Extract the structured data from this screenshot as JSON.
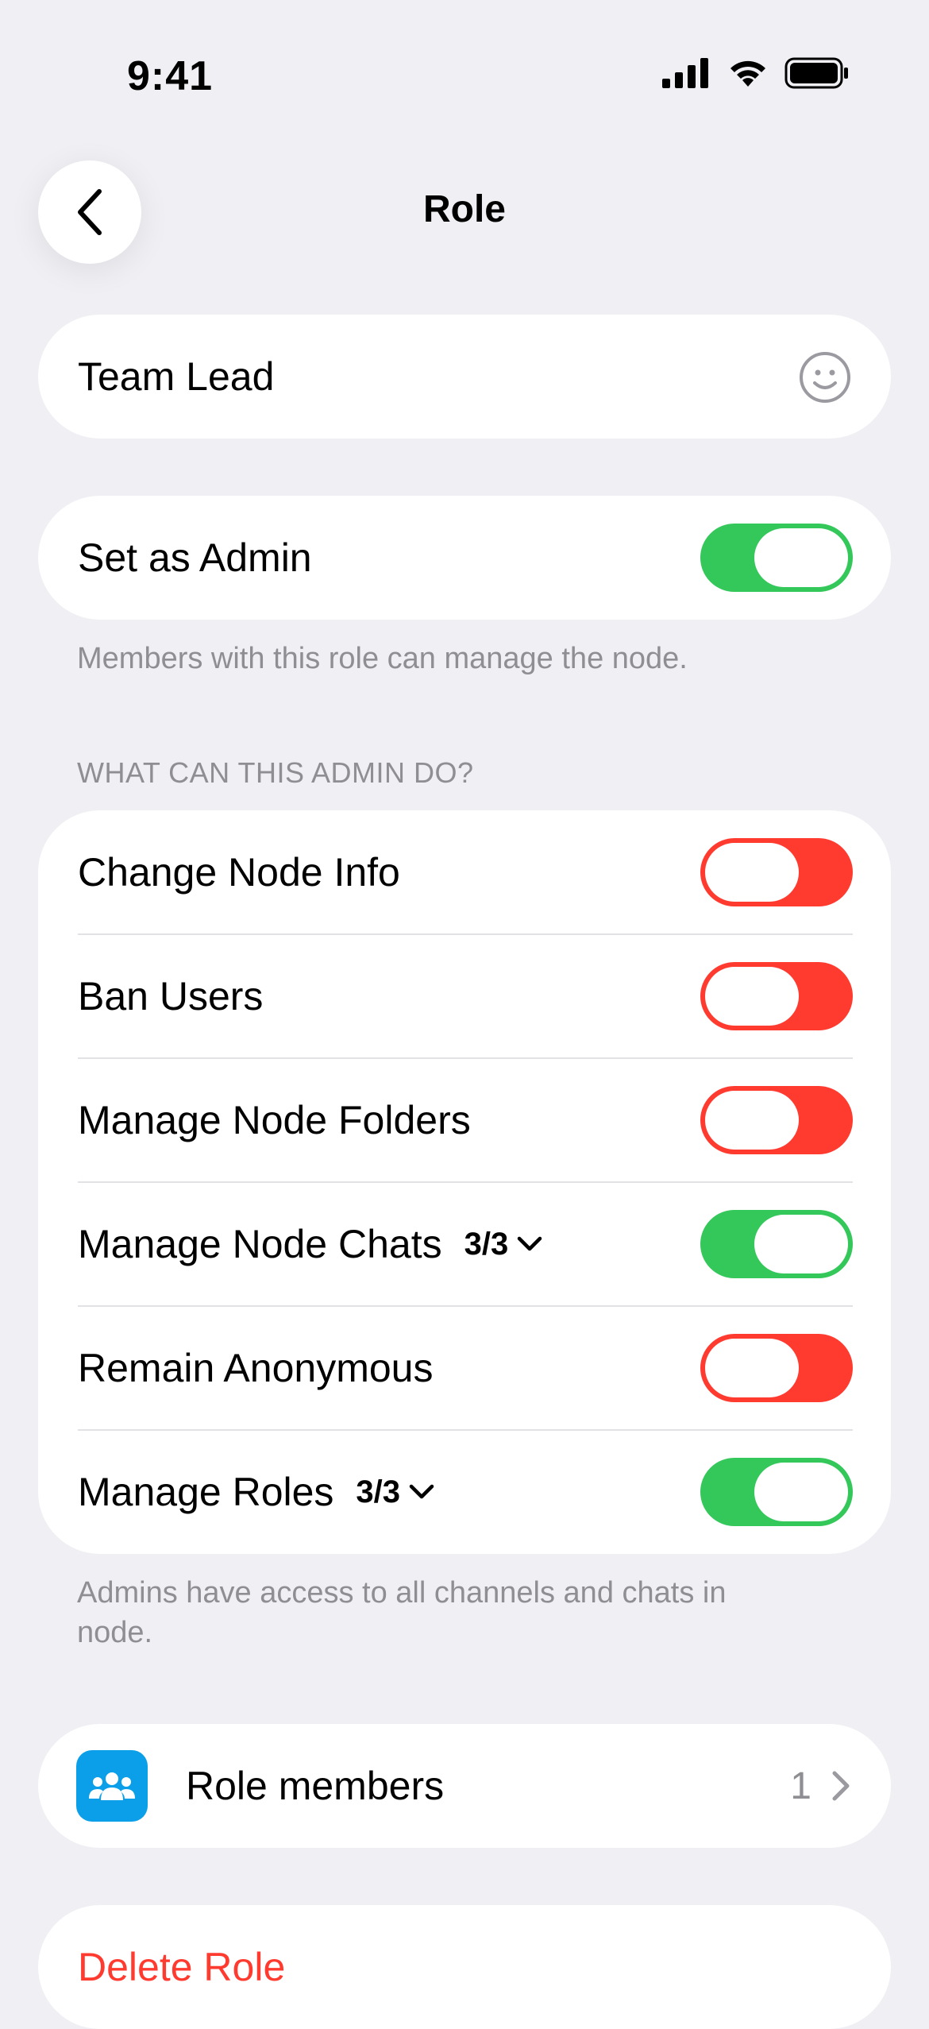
{
  "status_bar": {
    "time": "9:41"
  },
  "nav": {
    "title": "Role",
    "back_icon": "chevron-left-icon"
  },
  "role_name": {
    "value": "Team Lead",
    "icon": "smiley-icon"
  },
  "admin": {
    "label": "Set as Admin",
    "enabled": true,
    "footnote": "Members with this role can manage the node."
  },
  "permissions": {
    "header": "WHAT CAN THIS ADMIN DO?",
    "items": [
      {
        "label": "Change Node Info",
        "enabled": false
      },
      {
        "label": "Ban Users",
        "enabled": false
      },
      {
        "label": "Manage Node Folders",
        "enabled": false
      },
      {
        "label": "Manage Node Chats",
        "counter": "3/3",
        "enabled": true
      },
      {
        "label": "Remain Anonymous",
        "enabled": false
      },
      {
        "label": "Manage Roles",
        "counter": "3/3",
        "enabled": true
      }
    ],
    "footnote_line1": "Admins have access to all channels and chats in",
    "footnote_line2": "node."
  },
  "members": {
    "label": "Role members",
    "count": "1",
    "icon": "people-icon"
  },
  "delete": {
    "label": "Delete Role"
  },
  "colors": {
    "on": "#34C759",
    "off": "#FF3B30",
    "accent_blue": "#0A9FE8",
    "background": "#EFEFF4"
  }
}
